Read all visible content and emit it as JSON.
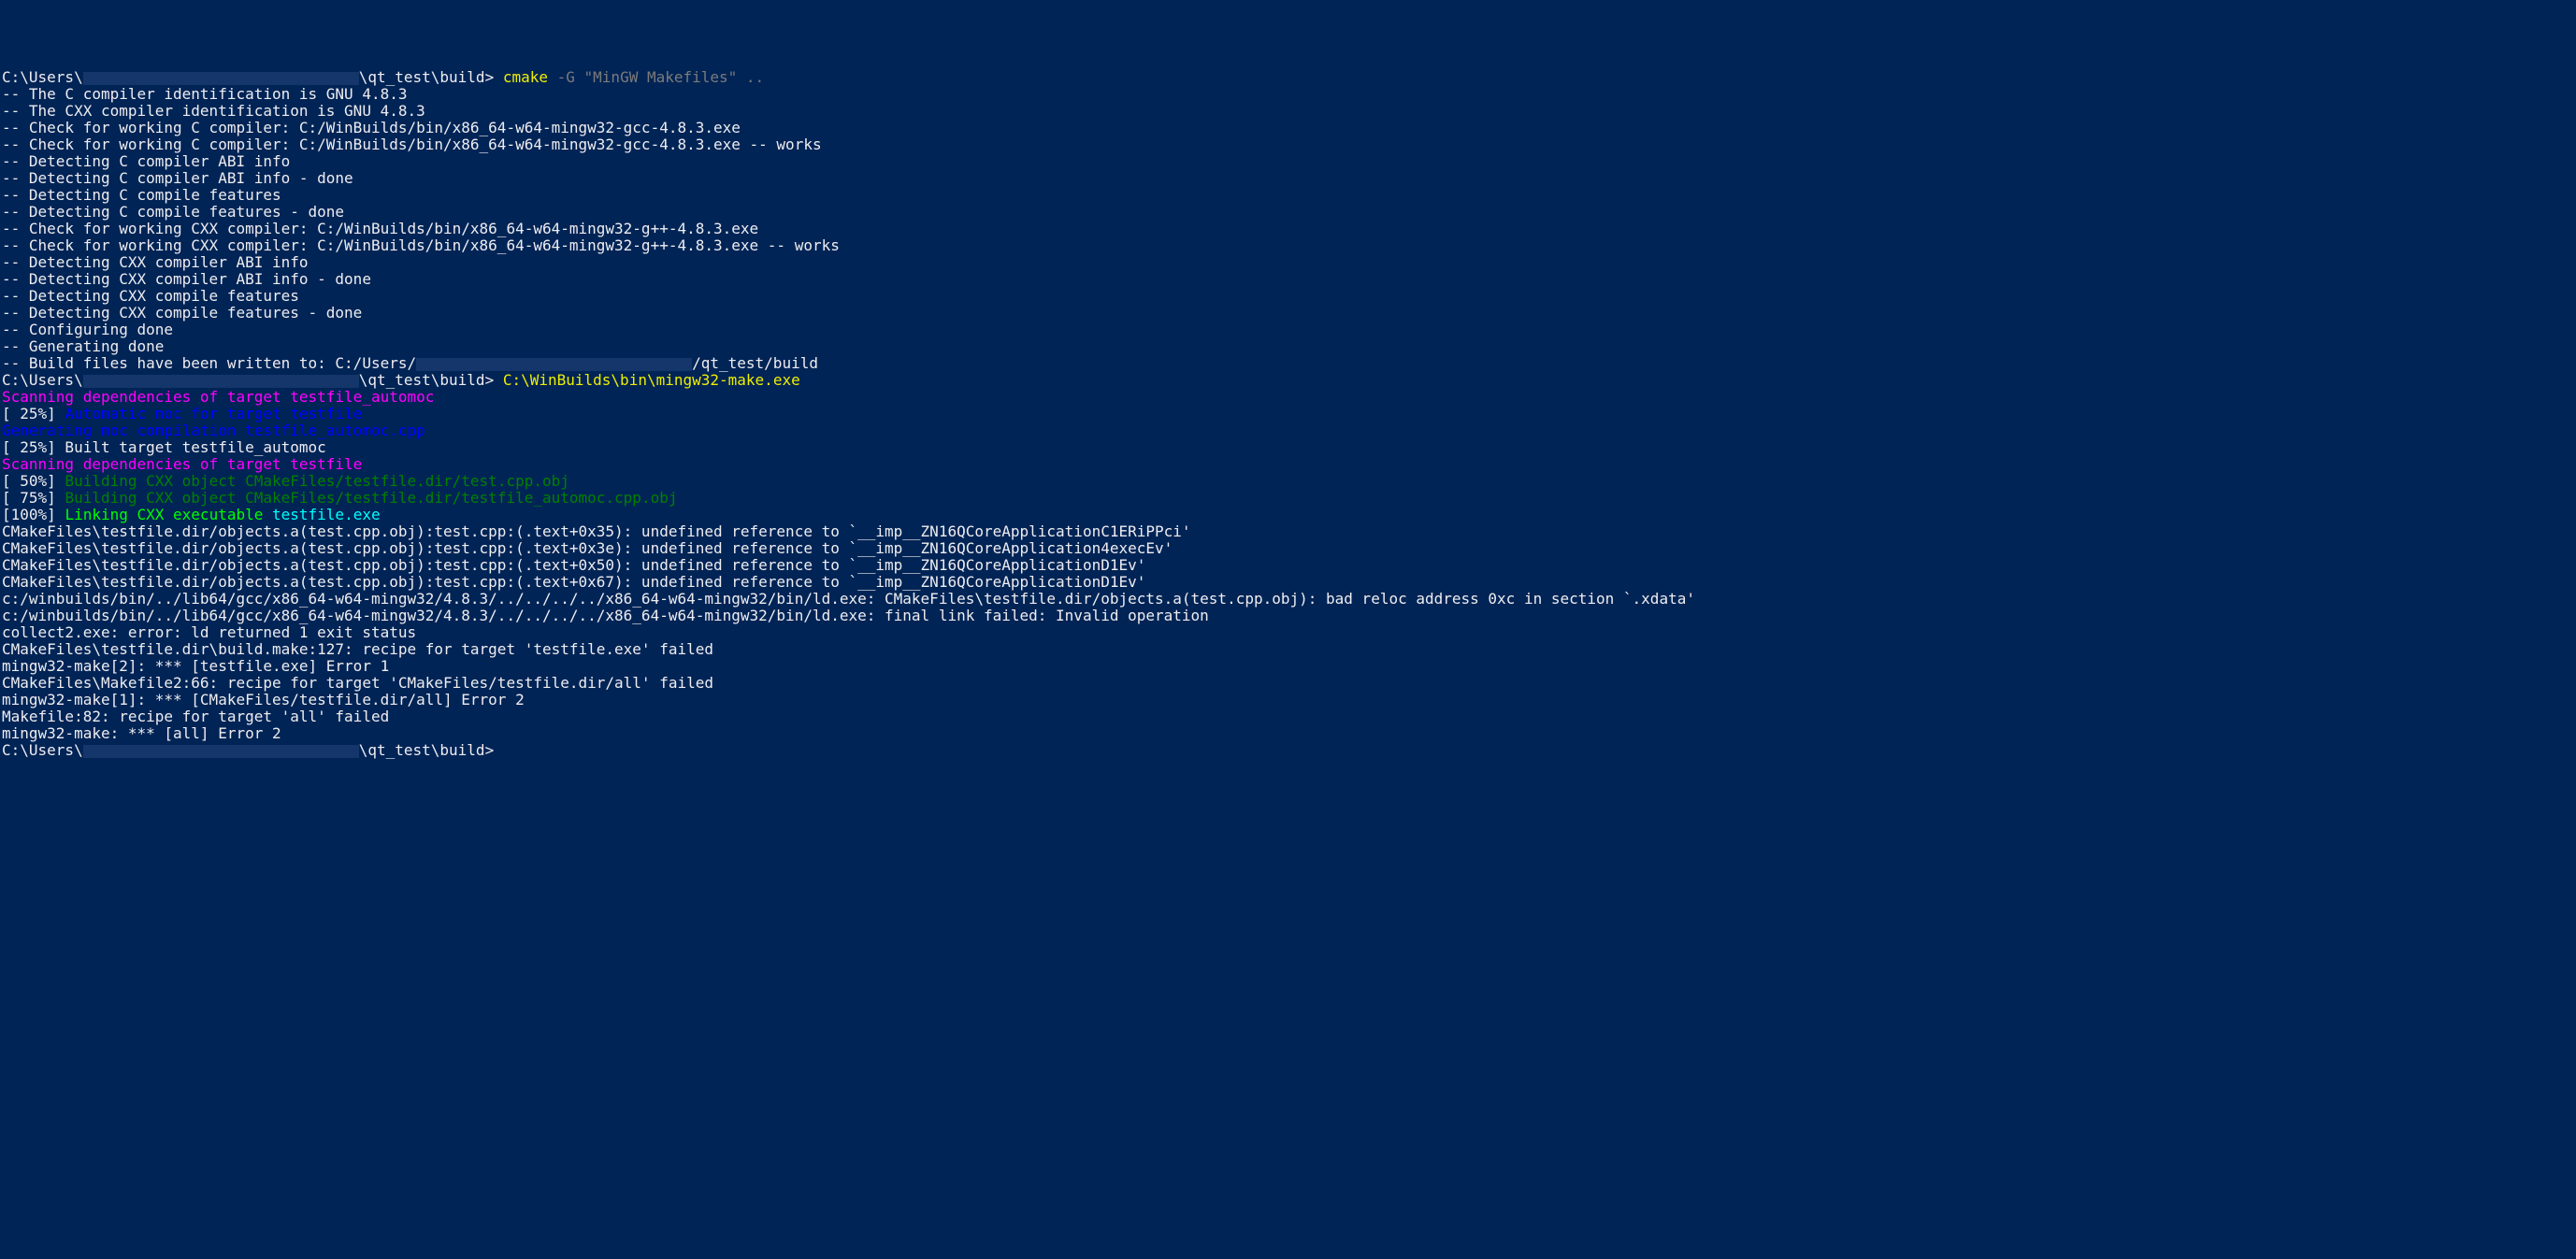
{
  "prompt1": {
    "prefix": "C:\\Users\\",
    "redact_width": 295,
    "suffix": "\\qt_test\\build> ",
    "cmd": "cmake",
    "args": " -G \"MinGW Makefiles\" .."
  },
  "cmake_output": [
    "-- The C compiler identification is GNU 4.8.3",
    "-- The CXX compiler identification is GNU 4.8.3",
    "-- Check for working C compiler: C:/WinBuilds/bin/x86_64-w64-mingw32-gcc-4.8.3.exe",
    "-- Check for working C compiler: C:/WinBuilds/bin/x86_64-w64-mingw32-gcc-4.8.3.exe -- works",
    "-- Detecting C compiler ABI info",
    "-- Detecting C compiler ABI info - done",
    "-- Detecting C compile features",
    "-- Detecting C compile features - done",
    "-- Check for working CXX compiler: C:/WinBuilds/bin/x86_64-w64-mingw32-g++-4.8.3.exe",
    "-- Check for working CXX compiler: C:/WinBuilds/bin/x86_64-w64-mingw32-g++-4.8.3.exe -- works",
    "-- Detecting CXX compiler ABI info",
    "-- Detecting CXX compiler ABI info - done",
    "-- Detecting CXX compile features",
    "-- Detecting CXX compile features - done",
    "-- Configuring done",
    "-- Generating done"
  ],
  "written_to": {
    "prefix": "-- Build files have been written to: C:/Users/",
    "redact_width": 295,
    "suffix": "/qt_test/build"
  },
  "prompt2": {
    "prefix": "C:\\Users\\",
    "redact_width": 295,
    "suffix": "\\qt_test\\build> ",
    "cmd": "C:\\WinBuilds\\bin\\mingw32-make.exe"
  },
  "scan1": "Scanning dependencies of target testfile_automoc",
  "step25a": {
    "pct": "[ 25%] ",
    "msg": "Automatic moc for target testfile"
  },
  "gen_moc": "Generating moc compilation testfile_automoc.cpp",
  "step25b": {
    "pct": "[ 25%]",
    "msg": " Built target testfile_automoc"
  },
  "scan2": "Scanning dependencies of target testfile",
  "step50": {
    "pct": "[ 50%] ",
    "msg": "Building CXX object CMakeFiles/testfile.dir/test.cpp.obj"
  },
  "step75": {
    "pct": "[ 75%] ",
    "msg": "Building CXX object CMakeFiles/testfile.dir/testfile_automoc.cpp.obj"
  },
  "step100": {
    "pct": "[100%] ",
    "msg_a": "Linking CXX executable ",
    "msg_b": "testfile.exe"
  },
  "errors": [
    "CMakeFiles\\testfile.dir/objects.a(test.cpp.obj):test.cpp:(.text+0x35): undefined reference to `__imp__ZN16QCoreApplicationC1ERiPPci'",
    "CMakeFiles\\testfile.dir/objects.a(test.cpp.obj):test.cpp:(.text+0x3e): undefined reference to `__imp__ZN16QCoreApplication4execEv'",
    "CMakeFiles\\testfile.dir/objects.a(test.cpp.obj):test.cpp:(.text+0x50): undefined reference to `__imp__ZN16QCoreApplicationD1Ev'",
    "CMakeFiles\\testfile.dir/objects.a(test.cpp.obj):test.cpp:(.text+0x67): undefined reference to `__imp__ZN16QCoreApplicationD1Ev'",
    "c:/winbuilds/bin/../lib64/gcc/x86_64-w64-mingw32/4.8.3/../../../../x86_64-w64-mingw32/bin/ld.exe: CMakeFiles\\testfile.dir/objects.a(test.cpp.obj): bad reloc address 0xc in section `.xdata'",
    "c:/winbuilds/bin/../lib64/gcc/x86_64-w64-mingw32/4.8.3/../../../../x86_64-w64-mingw32/bin/ld.exe: final link failed: Invalid operation",
    "collect2.exe: error: ld returned 1 exit status",
    "CMakeFiles\\testfile.dir\\build.make:127: recipe for target 'testfile.exe' failed",
    "mingw32-make[2]: *** [testfile.exe] Error 1",
    "CMakeFiles\\Makefile2:66: recipe for target 'CMakeFiles/testfile.dir/all' failed",
    "mingw32-make[1]: *** [CMakeFiles/testfile.dir/all] Error 2",
    "Makefile:82: recipe for target 'all' failed",
    "mingw32-make: *** [all] Error 2"
  ],
  "prompt3": {
    "prefix": "C:\\Users\\",
    "redact_width": 295,
    "suffix": "\\qt_test\\build>"
  }
}
